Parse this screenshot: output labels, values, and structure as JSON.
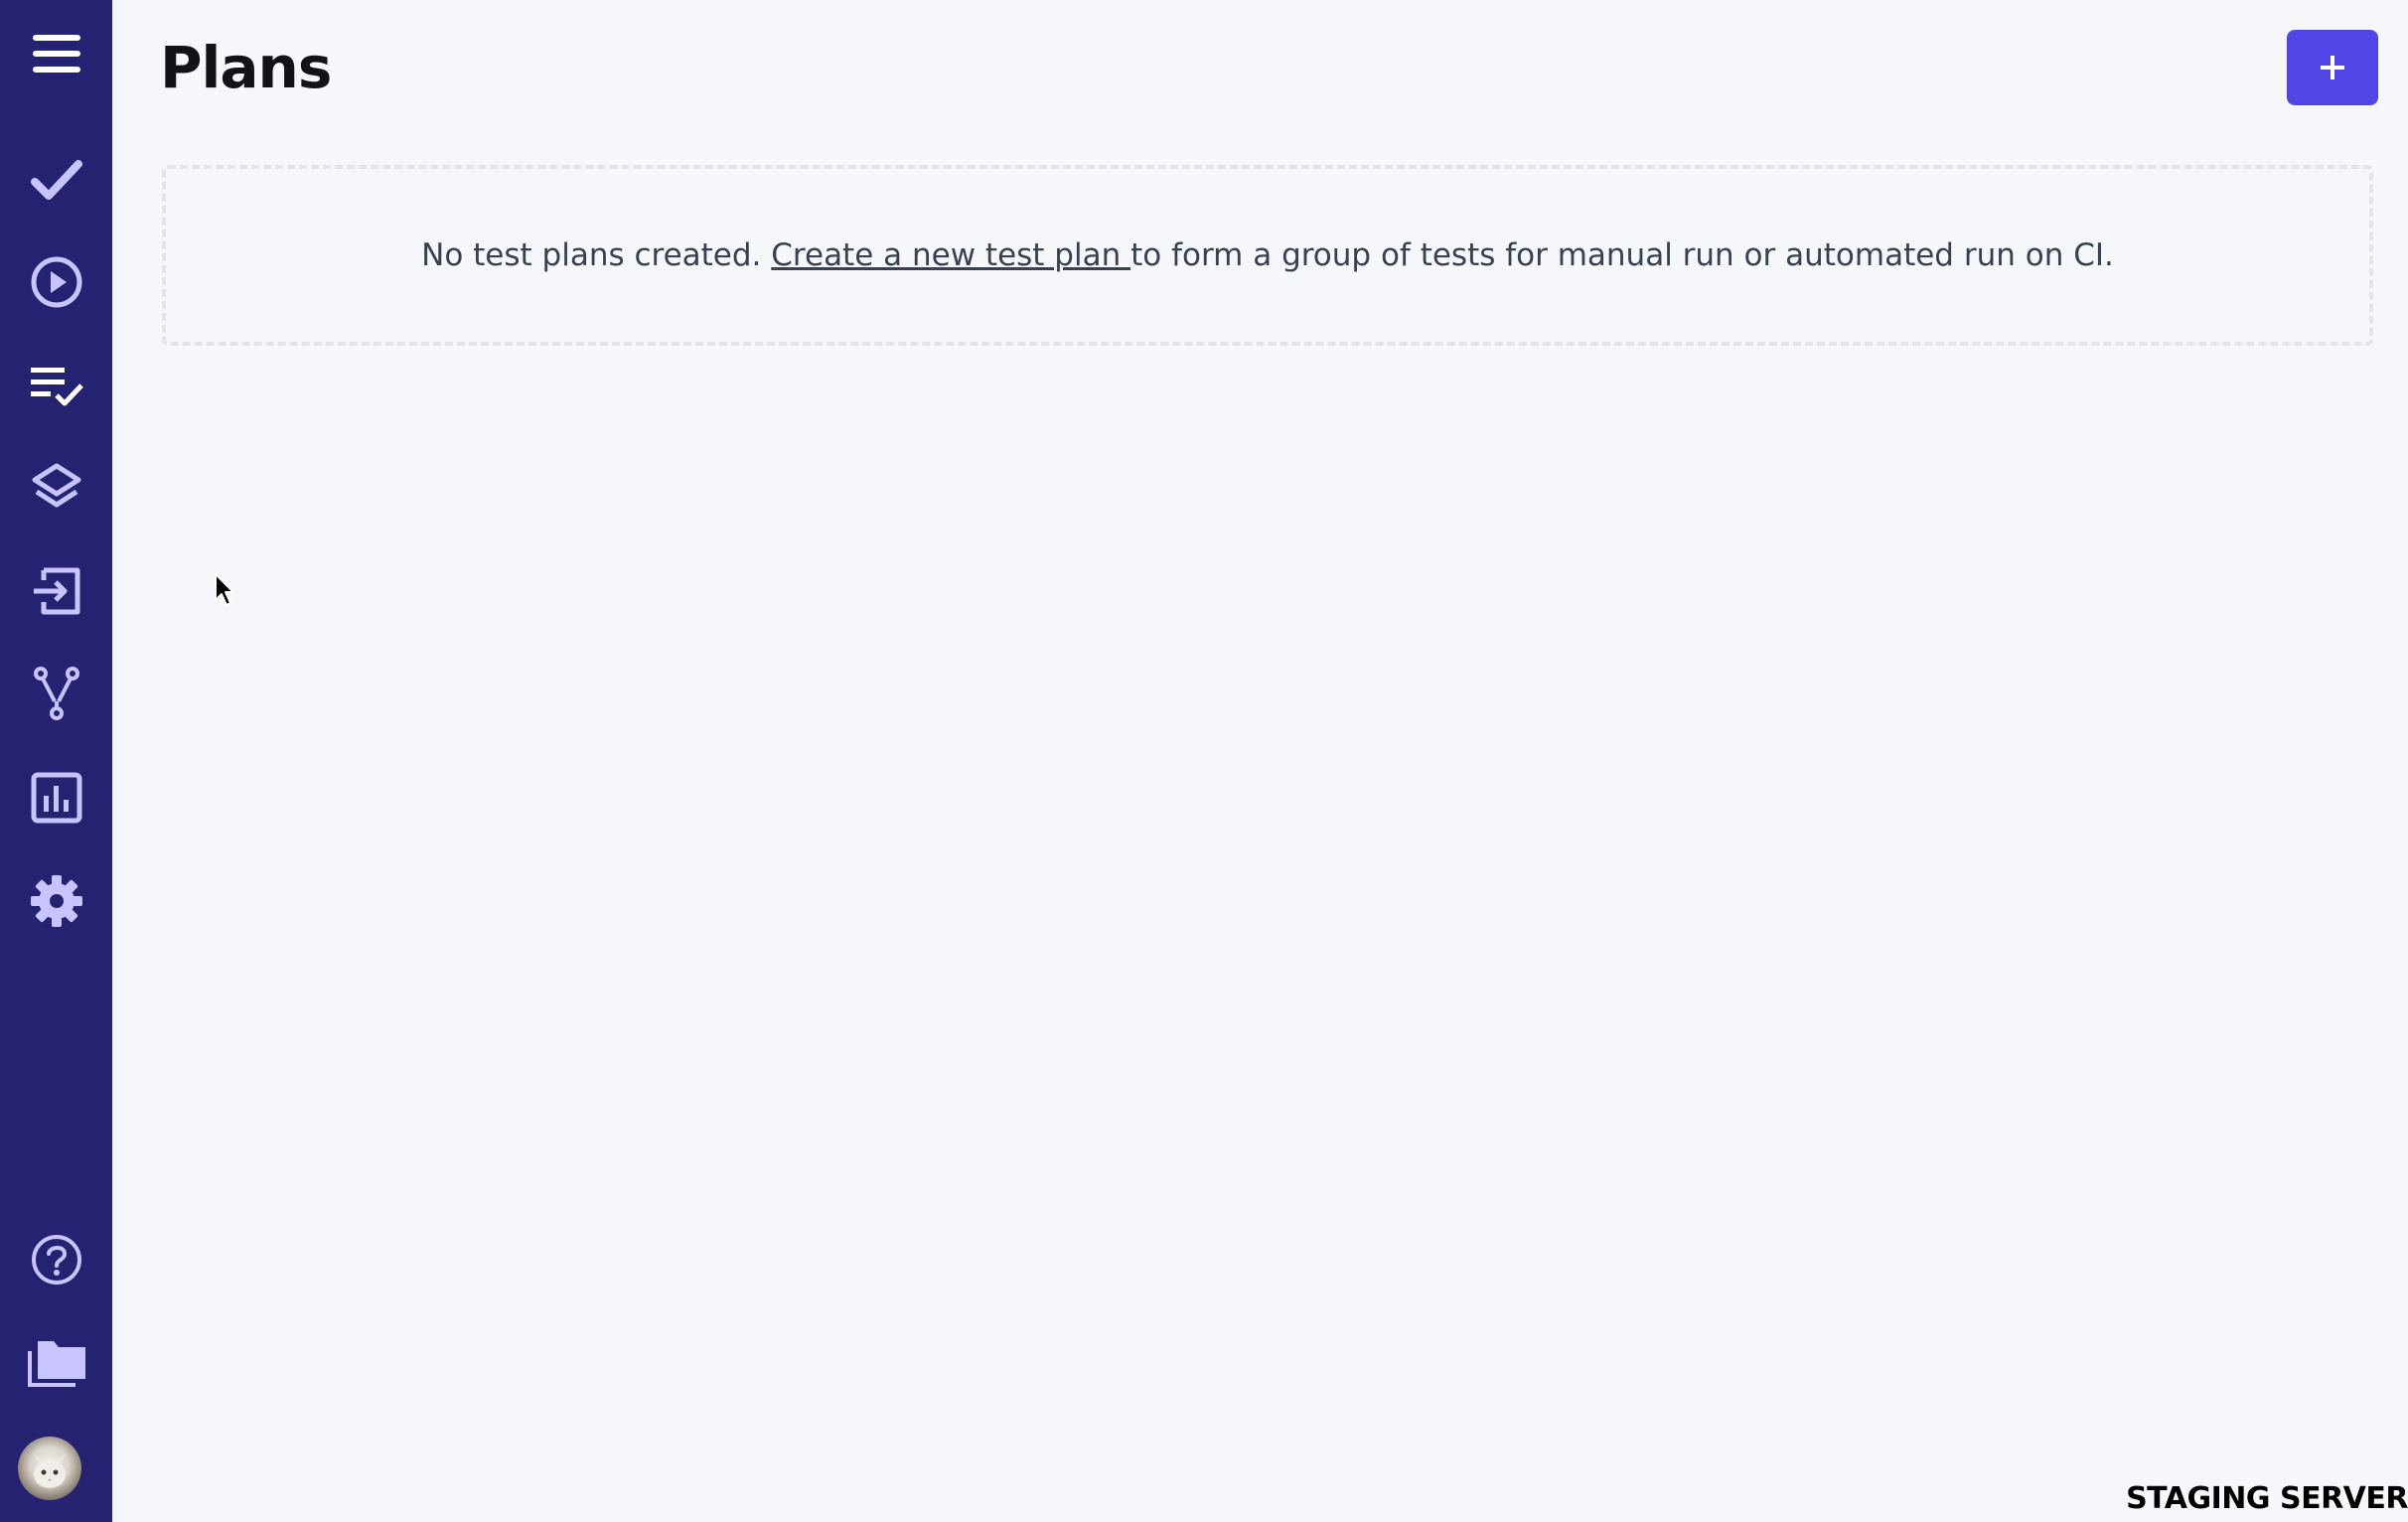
{
  "sidebar": {
    "items": [
      {
        "icon": "menu-icon"
      },
      {
        "icon": "checkmark-icon"
      },
      {
        "icon": "play-circle-icon"
      },
      {
        "icon": "checklist-icon"
      },
      {
        "icon": "layers-icon"
      },
      {
        "icon": "import-icon"
      },
      {
        "icon": "branch-icon"
      },
      {
        "icon": "analytics-icon"
      },
      {
        "icon": "gear-icon"
      },
      {
        "icon": "help-icon"
      },
      {
        "icon": "folders-icon"
      }
    ],
    "colors": {
      "background": "#262272",
      "icon": "#c7c4ff"
    }
  },
  "header": {
    "title": "Plans",
    "add_button_label": "+"
  },
  "empty_state": {
    "text_before": "No test plans created. ",
    "link_text": "Create a new test plan ",
    "text_after": "to form a group of tests for manual run or automated run on CI."
  },
  "footer": {
    "server_label": "STAGING SERVER"
  },
  "colors": {
    "accent": "#5046e5",
    "background": "#f6f7fb"
  }
}
